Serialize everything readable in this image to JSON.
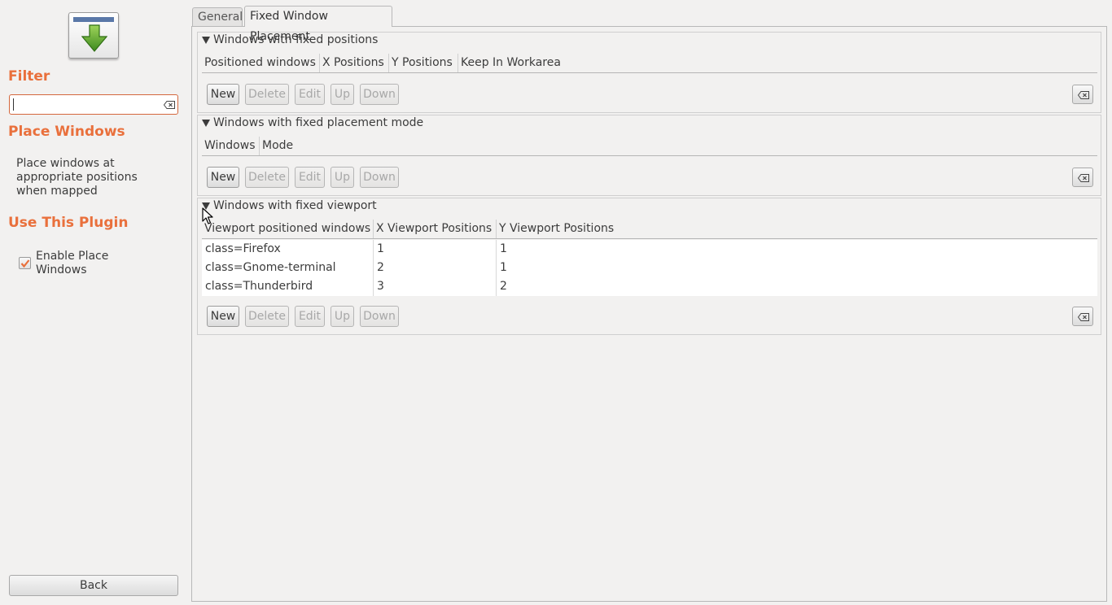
{
  "sidebar": {
    "filter_title": "Filter",
    "filter_value": "",
    "plugin_title": "Place Windows",
    "plugin_description": "Place windows at appropriate positions when mapped",
    "use_title": "Use This Plugin",
    "enable_label": "Enable Place Windows",
    "enable_checked": true,
    "back_label": "Back",
    "accent_color": "#e9703c"
  },
  "tabs": [
    {
      "label": "General",
      "active": false
    },
    {
      "label": "Fixed Window Placement",
      "active": true
    }
  ],
  "sections": {
    "positions": {
      "title": "Windows with fixed positions",
      "columns": [
        "Positioned windows",
        "X Positions",
        "Y Positions",
        "Keep In Workarea"
      ],
      "rows": []
    },
    "mode": {
      "title": "Windows with fixed placement mode",
      "columns": [
        "Windows",
        "Mode"
      ],
      "rows": []
    },
    "viewport": {
      "title": "Windows with fixed viewport",
      "columns": [
        "Viewport positioned windows",
        "X Viewport Positions",
        "Y Viewport Positions"
      ],
      "rows": [
        [
          "class=Firefox",
          "1",
          "1"
        ],
        [
          "class=Gnome-terminal",
          "2",
          "1"
        ],
        [
          "class=Thunderbird",
          "3",
          "2"
        ]
      ]
    }
  },
  "buttons": {
    "new": "New",
    "delete": "Delete",
    "edit": "Edit",
    "up": "Up",
    "down": "Down"
  }
}
